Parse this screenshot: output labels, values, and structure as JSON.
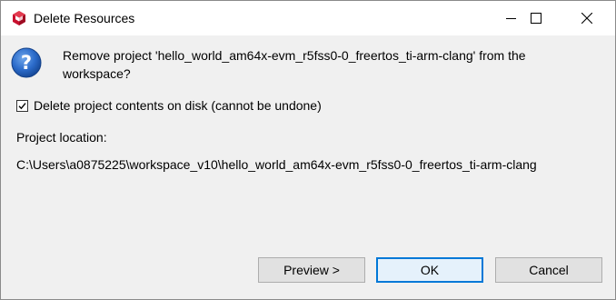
{
  "window": {
    "title": "Delete Resources",
    "controls": {
      "minimize": "minimize-icon",
      "maximize": "maximize-icon",
      "close": "close-icon"
    }
  },
  "dialog": {
    "icon": "question-icon",
    "message": "Remove project 'hello_world_am64x-evm_r5fss0-0_freertos_ti-arm-clang' from the workspace?",
    "delete_contents": {
      "checked": true,
      "label": "Delete project contents on disk (cannot be undone)"
    },
    "location_label": "Project location:",
    "location_value": "C:\\Users\\a0875225\\workspace_v10\\hello_world_am64x-evm_r5fss0-0_freertos_ti-arm-clang"
  },
  "buttons": {
    "preview": "Preview >",
    "ok": "OK",
    "cancel": "Cancel"
  },
  "colors": {
    "accent": "#0078d7",
    "app_icon": "#c8102e",
    "question_icon": "#1f5fb5"
  }
}
